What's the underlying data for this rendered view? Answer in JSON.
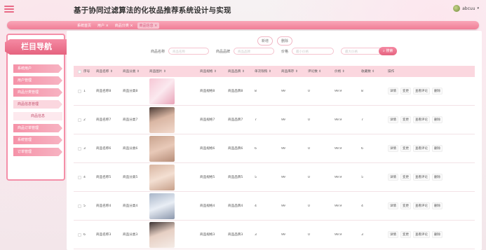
{
  "header": {
    "title": "基于协同过滤算法的化妆品推荐系统设计与实现",
    "user": "abcuu"
  },
  "breadcrumbs": [
    {
      "label": "系统首页",
      "active": false
    },
    {
      "label": "用户 ×",
      "active": false
    },
    {
      "label": "商品分类 ×",
      "active": false
    },
    {
      "label": "商品信息 ×",
      "active": true
    }
  ],
  "sidebar": {
    "title": "栏目导航",
    "items": [
      {
        "label": "系统用户",
        "active": false
      },
      {
        "label": "用户管理",
        "active": false
      },
      {
        "label": "商品分类管理",
        "active": false
      },
      {
        "label": "商品信息管理",
        "active": true
      }
    ],
    "sub_item": "商品信息",
    "items_after": [
      {
        "label": "商品订单管理"
      },
      {
        "label": "系统管理"
      },
      {
        "label": "订单管理"
      }
    ]
  },
  "toolbar": {
    "add_label": "新增",
    "delete_label": "删除",
    "search_label": "搜索"
  },
  "search": {
    "name_label": "商品名称",
    "name_placeholder": "商品名称",
    "brand_label": "商品品牌",
    "brand_placeholder": "商品品牌",
    "price_label": "价格",
    "price_min_placeholder": "最小价格",
    "price_max_placeholder": "最大价格"
  },
  "table": {
    "headers": [
      "",
      "序号",
      "商品名称 ⇕",
      "商品分类 ⇕",
      "商品图片 ⇕",
      "商品规格 ⇕",
      "商品品牌 ⇕",
      "单次限购 ⇕",
      "商品库存 ⇕",
      "评论数 ⇕",
      "价格 ⇕",
      "收藏数 ⇕",
      "操作"
    ],
    "ops": [
      "详情",
      "变更",
      "查看评论",
      "删除"
    ],
    "rows": [
      {
        "idx": "1",
        "name": "商品名称8",
        "cat": "商品分类8",
        "spec": "商品规格8",
        "brand": "商品品牌8",
        "limit": "8",
        "stock": "99",
        "comments": "0",
        "price": "99.9",
        "fav": "8"
      },
      {
        "idx": "2",
        "name": "商品名称7",
        "cat": "商品分类7",
        "spec": "商品规格7",
        "brand": "商品品牌7",
        "limit": "7",
        "stock": "99",
        "comments": "0",
        "price": "99.9",
        "fav": "7"
      },
      {
        "idx": "3",
        "name": "商品名称6",
        "cat": "商品分类6",
        "spec": "商品规格6",
        "brand": "商品品牌6",
        "limit": "6",
        "stock": "99",
        "comments": "0",
        "price": "99.9",
        "fav": "6"
      },
      {
        "idx": "4",
        "name": "商品名称5",
        "cat": "商品分类5",
        "spec": "商品规格5",
        "brand": "商品品牌5",
        "limit": "5",
        "stock": "99",
        "comments": "0",
        "price": "99.9",
        "fav": "5"
      },
      {
        "idx": "5",
        "name": "商品名称4",
        "cat": "商品分类4",
        "spec": "商品规格4",
        "brand": "商品品牌4",
        "limit": "4",
        "stock": "99",
        "comments": "0",
        "price": "99.9",
        "fav": "4"
      },
      {
        "idx": "6",
        "name": "商品名称3",
        "cat": "商品分类3",
        "spec": "商品规格3",
        "brand": "商品品牌3",
        "limit": "3",
        "stock": "99",
        "comments": "0",
        "price": "99.9",
        "fav": "3"
      }
    ]
  },
  "colors": {
    "accent": "#e86a86",
    "header_row": "#fbd7df"
  }
}
